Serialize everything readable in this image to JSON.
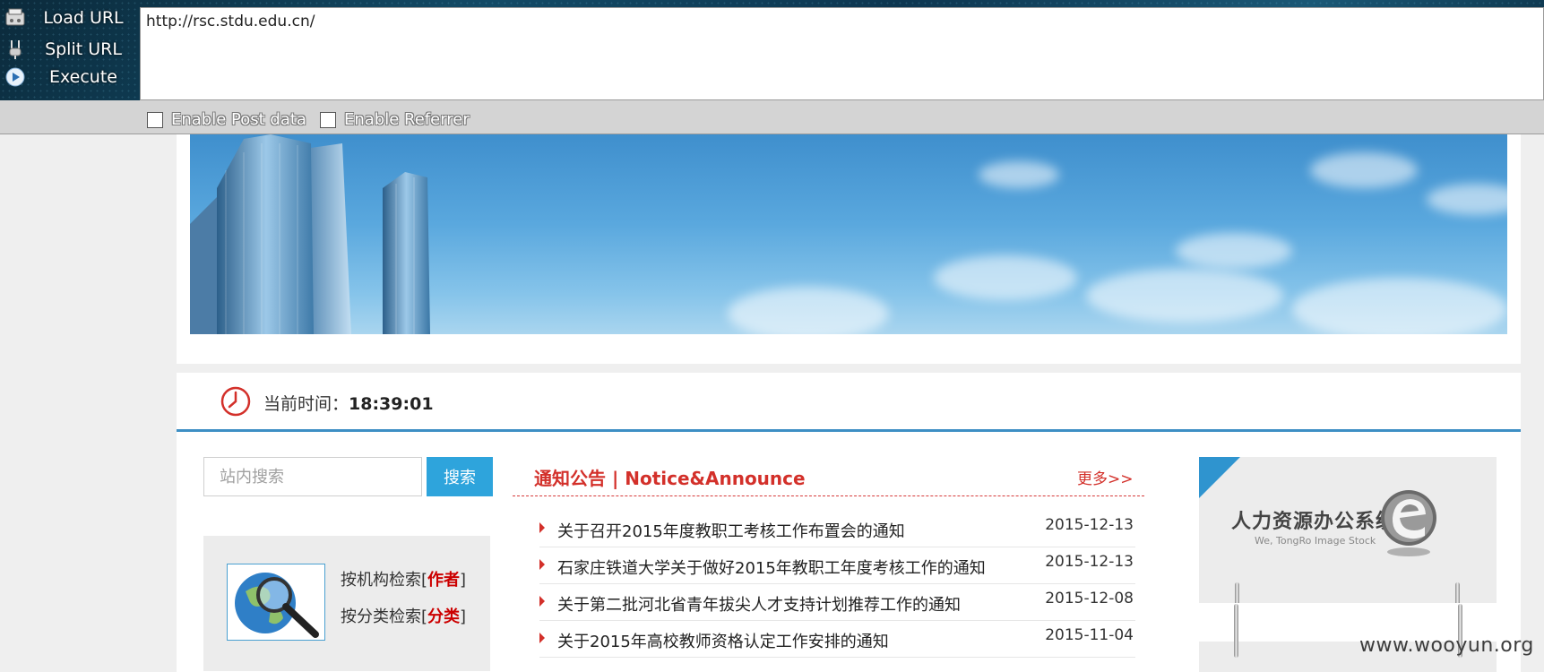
{
  "hackbar": {
    "buttons": [
      {
        "label": "Load URL",
        "icon": "load-url-icon"
      },
      {
        "label": "Split URL",
        "icon": "split-url-icon"
      },
      {
        "label": "Execute",
        "icon": "execute-icon"
      }
    ],
    "url_value": "http://rsc.stdu.edu.cn/",
    "options": [
      {
        "label": "Enable Post data",
        "checked": false
      },
      {
        "label": "Enable Referrer",
        "checked": false
      }
    ]
  },
  "timebar": {
    "label": "当前时间：",
    "time": "18:39:01",
    "icon": "clock-icon"
  },
  "search": {
    "placeholder": "站内搜索",
    "button": "搜索"
  },
  "lookup": {
    "by_org_prefix": "按机构检索[",
    "by_org_em": "作者",
    "by_cat_prefix": "按分类检索[",
    "by_cat_em": "分类",
    "suffix": "]",
    "icon": "globe-magnifier-icon"
  },
  "news": {
    "title": "通知公告 | Notice&Announce",
    "more": "更多>>",
    "items": [
      {
        "title": "关于召开2015年度教职工考核工作布置会的通知",
        "date": "2015-12-13"
      },
      {
        "title": "石家庄铁道大学关于做好2015年教职工年度考核工作的通知",
        "date": "2015-12-13"
      },
      {
        "title": "关于第二批河北省青年拔尖人才支持计划推荐工作的通知",
        "date": "2015-12-08"
      },
      {
        "title": "关于2015年高校教师资格认定工作安排的通知",
        "date": "2015-11-04"
      }
    ]
  },
  "hr_system": {
    "title": "人力资源办公系统",
    "subtitle": "We, TongRo Image Stock"
  },
  "watermark": "www.wooyun.org",
  "colors": {
    "accent_red": "#d3302a",
    "accent_blue": "#2ea4dc",
    "timebar_border": "#3d8fc4"
  }
}
